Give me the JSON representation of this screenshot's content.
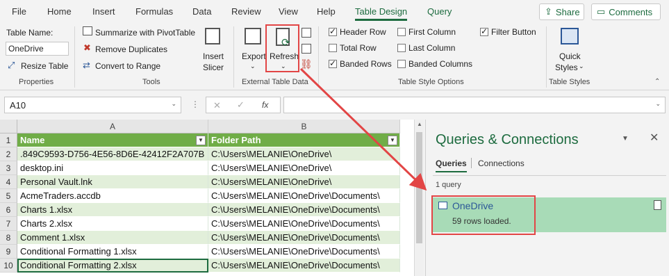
{
  "menu": {
    "tabs": [
      "File",
      "Home",
      "Insert",
      "Formulas",
      "Data",
      "Review",
      "View",
      "Help",
      "Table Design",
      "Query"
    ],
    "active_tab": "Table Design",
    "share_label": "Share",
    "comments_label": "Comments"
  },
  "ribbon": {
    "properties": {
      "table_name_label": "Table Name:",
      "table_name_value": "OneDrive",
      "resize_label": "Resize Table",
      "group_label": "Properties"
    },
    "tools": {
      "pivot_label": "Summarize with PivotTable",
      "dupes_label": "Remove Duplicates",
      "range_label": "Convert to Range",
      "slicer_label_1": "Insert",
      "slicer_label_2": "Slicer",
      "group_label": "Tools"
    },
    "external": {
      "export_label": "Export",
      "refresh_label": "Refresh",
      "group_label": "External Table Data"
    },
    "style_options": {
      "header_row": "Header Row",
      "total_row": "Total Row",
      "banded_rows": "Banded Rows",
      "first_column": "First Column",
      "last_column": "Last Column",
      "banded_columns": "Banded Columns",
      "filter_button": "Filter Button",
      "group_label": "Table Style Options"
    },
    "table_styles": {
      "quick_1": "Quick",
      "quick_2": "Styles",
      "group_label": "Table Styles"
    }
  },
  "formula_bar": {
    "name_box": "A10",
    "fx": "fx",
    "formula": ""
  },
  "sheet": {
    "columns": [
      "A",
      "B"
    ],
    "headers": [
      "Name",
      "Folder Path"
    ],
    "rows": [
      {
        "num": "1",
        "name": "Name",
        "path": "Folder Path"
      },
      {
        "num": "2",
        "name": ".849C9593-D756-4E56-8D6E-42412F2A707B",
        "path": "C:\\Users\\MELANIE\\OneDrive\\"
      },
      {
        "num": "3",
        "name": "desktop.ini",
        "path": "C:\\Users\\MELANIE\\OneDrive\\"
      },
      {
        "num": "4",
        "name": "Personal Vault.lnk",
        "path": "C:\\Users\\MELANIE\\OneDrive\\"
      },
      {
        "num": "5",
        "name": "AcmeTraders.accdb",
        "path": "C:\\Users\\MELANIE\\OneDrive\\Documents\\"
      },
      {
        "num": "6",
        "name": "Charts 1.xlsx",
        "path": "C:\\Users\\MELANIE\\OneDrive\\Documents\\"
      },
      {
        "num": "7",
        "name": "Charts 2.xlsx",
        "path": "C:\\Users\\MELANIE\\OneDrive\\Documents\\"
      },
      {
        "num": "8",
        "name": "Comment 1.xlsx",
        "path": "C:\\Users\\MELANIE\\OneDrive\\Documents\\"
      },
      {
        "num": "9",
        "name": "Conditional Formatting 1.xlsx",
        "path": "C:\\Users\\MELANIE\\OneDrive\\Documents\\"
      },
      {
        "num": "10",
        "name": "Conditional Formatting 2.xlsx",
        "path": "C:\\Users\\MELANIE\\OneDrive\\Documents\\"
      }
    ]
  },
  "queries": {
    "title": "Queries & Connections",
    "tab_queries": "Queries",
    "tab_connections": "Connections",
    "count": "1 query",
    "item_name": "OneDrive",
    "item_status": "59 rows loaded."
  },
  "colors": {
    "accent": "#1d6b3f",
    "header_fill": "#70ad47",
    "band_fill": "#e2efda",
    "annotation": "#e24545"
  }
}
